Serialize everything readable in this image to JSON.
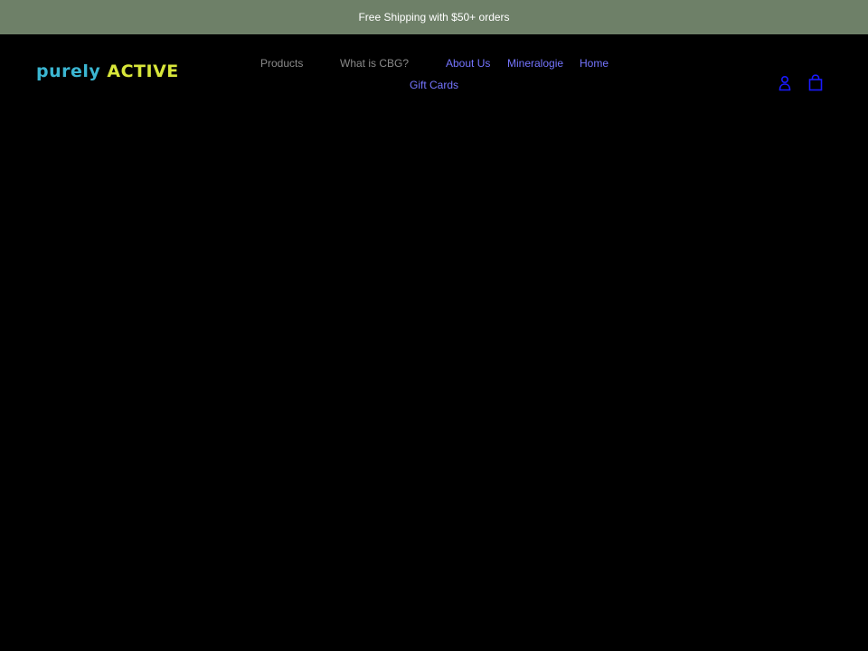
{
  "announcement": {
    "text": "Free Shipping with $50+ orders"
  },
  "header": {
    "logo": {
      "part1": "purely",
      "part2": "ACTIVE"
    },
    "nav": {
      "items": [
        {
          "label": "Products"
        },
        {
          "label": "What is CBG?"
        },
        {
          "label": "About Us"
        },
        {
          "label": "Mineralogie"
        },
        {
          "label": "Home"
        },
        {
          "label": "Gift Cards"
        }
      ]
    },
    "icons": {
      "account": "account-icon",
      "cart": "cart-icon"
    }
  },
  "colors": {
    "announcement_bg": "#6e8068",
    "page_bg": "#000000",
    "nav_muted": "#8a8a8a",
    "nav_link": "#7575ff",
    "icon": "#1a1aff",
    "logo_blue": "#3bb6d2",
    "logo_yellow": "#d8e63a"
  }
}
